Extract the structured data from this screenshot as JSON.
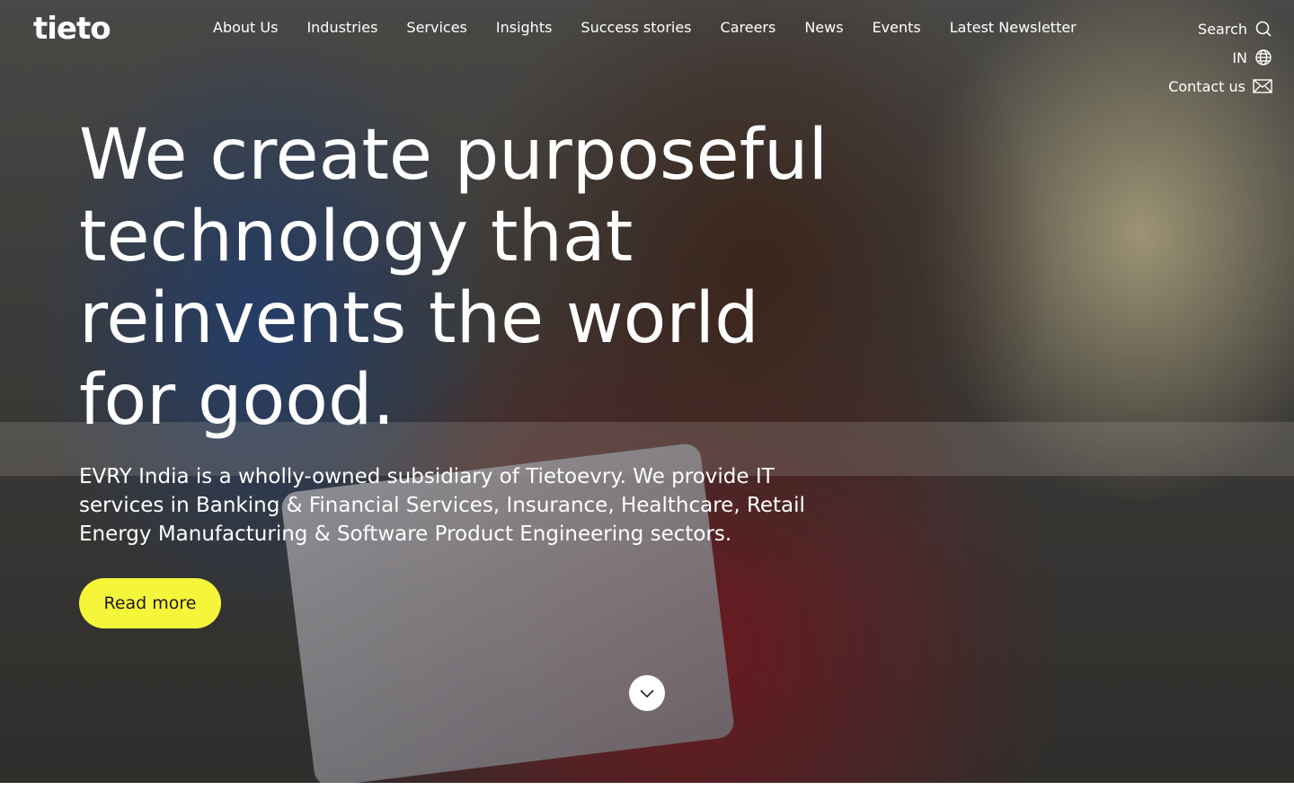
{
  "brand": {
    "logo_text": "tieto"
  },
  "nav": {
    "items": [
      {
        "label": "About Us"
      },
      {
        "label": "Industries"
      },
      {
        "label": "Services"
      },
      {
        "label": "Insights"
      },
      {
        "label": "Success stories"
      },
      {
        "label": "Careers"
      },
      {
        "label": "News"
      },
      {
        "label": "Events"
      },
      {
        "label": "Latest Newsletter"
      }
    ]
  },
  "utility": {
    "search_label": "Search",
    "region_label": "IN",
    "contact_label": "Contact us"
  },
  "hero": {
    "headline": "We create purposeful technology that reinvents the world for good.",
    "subtext": "EVRY India is a wholly-owned subsidiary of Tietoevry. We provide IT services in Banking & Financial Services, Insurance, Healthcare, Retail Energy Manufacturing & Software Product Engineering sectors.",
    "cta_label": "Read more"
  },
  "icons": {
    "search": "search-icon",
    "globe": "globe-icon",
    "mail": "mail-icon",
    "scroll": "chevron-down-icon"
  },
  "colors": {
    "cta_background": "#f5f53a",
    "text": "#ffffff"
  }
}
